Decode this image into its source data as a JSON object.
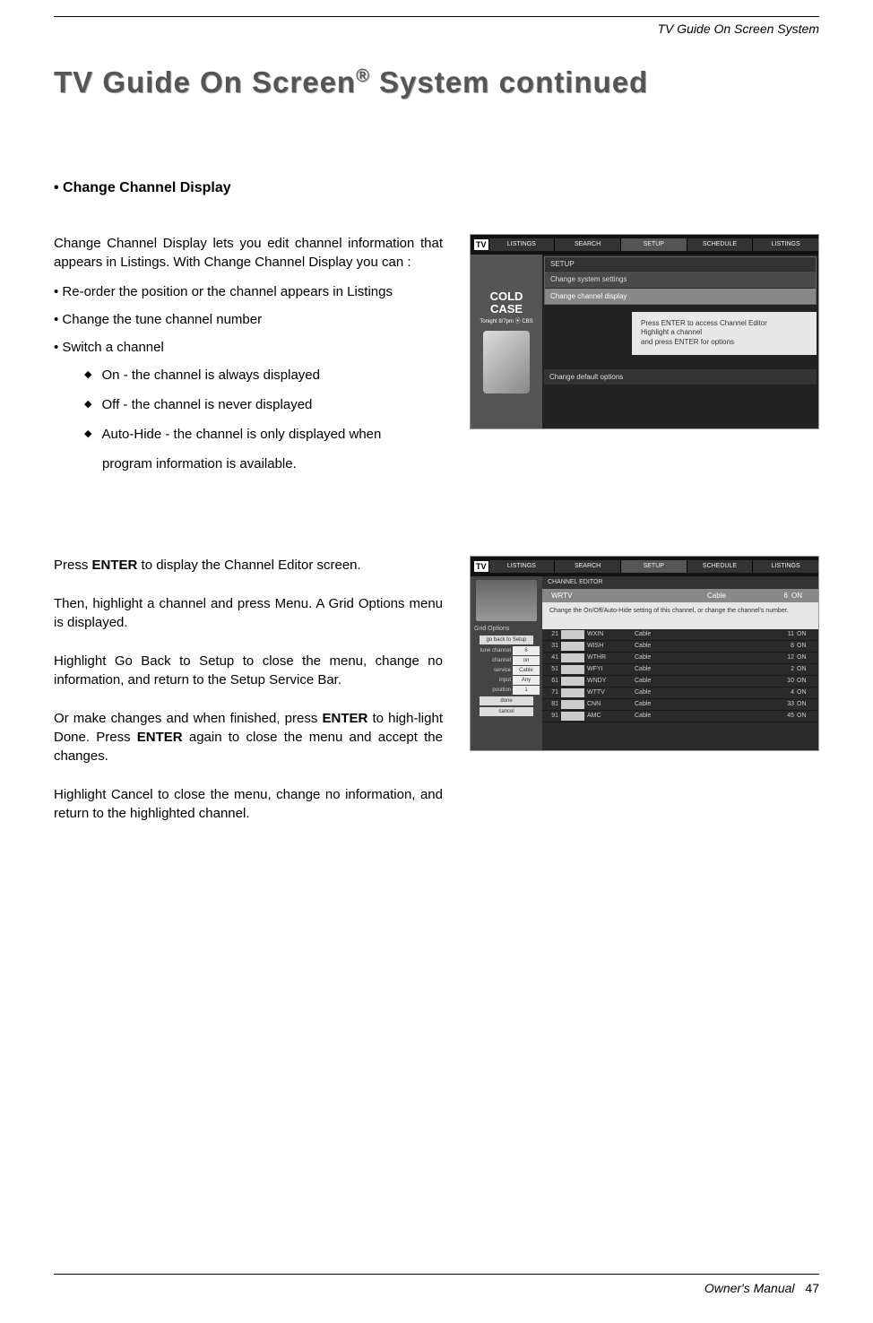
{
  "header": {
    "section": "TV Guide On Screen System"
  },
  "title": {
    "main": "TV Guide On Screen",
    "sup": "®",
    "rest": " System continued"
  },
  "subheading": "• Change Channel Display",
  "section1": {
    "intro": "Change Channel Display lets you edit channel information that appears in Listings. With Change Channel Display you can :",
    "b1": "Re-order the position or the channel appears in Listings",
    "b2": "Change the tune channel number",
    "b3": "Switch a channel",
    "s1": "On - the channel is always displayed",
    "s2": "Off - the channel is never displayed",
    "s3": "Auto-Hide - the channel is only displayed when",
    "s3b": "program information is available."
  },
  "shot1": {
    "logo": "TV",
    "tabs": [
      "LISTINGS",
      "SEARCH",
      "SETUP",
      "SCHEDULE",
      "LISTINGS"
    ],
    "promo_title_1": "COLD",
    "promo_title_2": "CASE",
    "promo_sub": "Tonight 8/7pm ⦿ CBS",
    "menu_hdr": "SETUP",
    "m1": "Change system settings",
    "m2": "Change channel display",
    "help1": "Press ENTER to access Channel Editor",
    "help2": "Highlight a channel",
    "help3": "and press ENTER for options",
    "m3": "Change default options"
  },
  "section2": {
    "p1a": "Press ",
    "p1b": "ENTER",
    "p1c": " to display the Channel Editor screen.",
    "p2": "Then, highlight a channel and press Menu. A Grid Options menu is displayed.",
    "p3": "Highlight Go Back to Setup to close the menu, change no information, and return to the Setup Service Bar.",
    "p4a": "Or make changes and when finished, press ",
    "p4b": "ENTER",
    "p4c": " to high-light Done. Press ",
    "p4d": "ENTER",
    "p4e": " again to close the menu and accept the changes.",
    "p5": "Highlight Cancel to close the menu, change no information, and return to the highlighted channel."
  },
  "shot2": {
    "logo": "TV",
    "tabs": [
      "LISTINGS",
      "SEARCH",
      "SETUP",
      "SCHEDULE",
      "LISTINGS"
    ],
    "ce_hdr": "CHANNEL EDITOR",
    "cur": {
      "name": "WRTV",
      "svc": "Cable",
      "num": "6",
      "state": "ON"
    },
    "desc": "Change the On/Off/Auto-Hide setting of this channel, or change the channel's number.",
    "opts_hdr": "Grid Options",
    "opt_goback": "go back to Setup",
    "opts": [
      {
        "label": "tune channel",
        "val": "6"
      },
      {
        "label": "channel",
        "val": "on"
      },
      {
        "label": "service",
        "val": "Cable"
      },
      {
        "label": "input",
        "val": "Any"
      },
      {
        "label": "position",
        "val": "1"
      }
    ],
    "opt_done": "done",
    "opt_cancel": "cancel",
    "rows": [
      {
        "n": "21",
        "nm": "WXIN",
        "sv": "Cable",
        "c2": "11",
        "on": "ON"
      },
      {
        "n": "31",
        "nm": "WISH",
        "sv": "Cable",
        "c2": "8",
        "on": "ON"
      },
      {
        "n": "41",
        "nm": "WTHR",
        "sv": "Cable",
        "c2": "12",
        "on": "ON"
      },
      {
        "n": "51",
        "nm": "WFYI",
        "sv": "Cable",
        "c2": "2",
        "on": "ON"
      },
      {
        "n": "61",
        "nm": "WNDY",
        "sv": "Cable",
        "c2": "10",
        "on": "ON"
      },
      {
        "n": "71",
        "nm": "WTTV",
        "sv": "Cable",
        "c2": "4",
        "on": "ON"
      },
      {
        "n": "81",
        "nm": "CNN",
        "sv": "Cable",
        "c2": "33",
        "on": "ON"
      },
      {
        "n": "91",
        "nm": "AMC",
        "sv": "Cable",
        "c2": "45",
        "on": "ON"
      }
    ]
  },
  "footer": {
    "label": "Owner's Manual",
    "page": "47"
  }
}
